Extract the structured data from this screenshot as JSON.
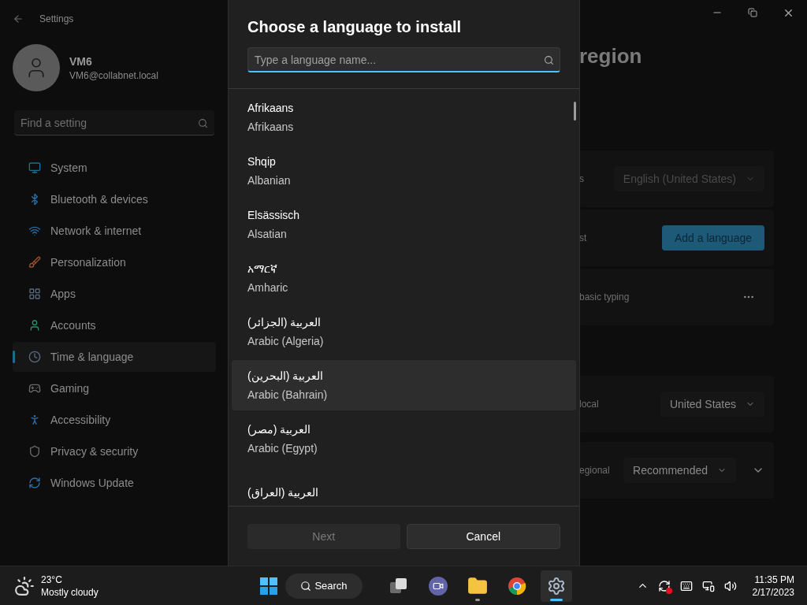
{
  "settings_window": {
    "title": "Settings"
  },
  "account": {
    "name": "VM6",
    "email": "VM6@collabnet.local"
  },
  "search": {
    "placeholder": "Find a setting"
  },
  "sidebar": {
    "items": [
      {
        "label": "System",
        "selected": false
      },
      {
        "label": "Bluetooth & devices",
        "selected": false
      },
      {
        "label": "Network & internet",
        "selected": false
      },
      {
        "label": "Personalization",
        "selected": false
      },
      {
        "label": "Apps",
        "selected": false
      },
      {
        "label": "Accounts",
        "selected": false
      },
      {
        "label": "Time & language",
        "selected": true
      },
      {
        "label": "Gaming",
        "selected": false
      },
      {
        "label": "Accessibility",
        "selected": false
      },
      {
        "label": "Privacy & security",
        "selected": false
      },
      {
        "label": "Windows Update",
        "selected": false
      }
    ]
  },
  "page": {
    "title": "region",
    "rows": [
      {
        "kind": "dropdown",
        "label": "s",
        "value": "English (United States)",
        "disabled": true
      },
      {
        "kind": "button",
        "label": "st",
        "value": "Add a language"
      },
      {
        "kind": "more",
        "label": "basic typing"
      },
      {
        "kind": "dropdown",
        "label": "local",
        "value": "United States",
        "disabled": false
      },
      {
        "kind": "dropdown",
        "label": "egional",
        "value": "Recommended",
        "disabled": false,
        "expandable": true
      }
    ]
  },
  "dialog": {
    "title": "Choose a language to install",
    "search": {
      "placeholder": "Type a language name..."
    },
    "languages": [
      {
        "native": "Afrikaans",
        "english": "Afrikaans",
        "selected": false
      },
      {
        "native": "Shqip",
        "english": "Albanian",
        "selected": false
      },
      {
        "native": "Elsässisch",
        "english": "Alsatian",
        "selected": false
      },
      {
        "native": "አማርኛ",
        "english": "Amharic",
        "selected": false
      },
      {
        "native": "العربية (الجزائر)",
        "english": "Arabic (Algeria)",
        "selected": false
      },
      {
        "native": "العربية (البحرين)",
        "english": "Arabic (Bahrain)",
        "selected": true
      },
      {
        "native": "العربية (مصر)",
        "english": "Arabic (Egypt)",
        "selected": false
      },
      {
        "native": "العربية (العراق)",
        "selected": false
      }
    ],
    "buttons": [
      {
        "label": "Next",
        "disabled": true
      },
      {
        "label": "Cancel",
        "disabled": false
      }
    ]
  },
  "taskbar": {
    "weather": {
      "temperature": "23°C",
      "condition": "Mostly cloudy"
    },
    "search": "Search",
    "apps": [
      {
        "running": false,
        "selected": false
      },
      {
        "running": false,
        "selected": false
      },
      {
        "running": true,
        "selected": false
      },
      {
        "running": false,
        "selected": false
      },
      {
        "running": true,
        "selected": true
      }
    ],
    "time": "11:35 PM",
    "date": "2/17/2023"
  }
}
